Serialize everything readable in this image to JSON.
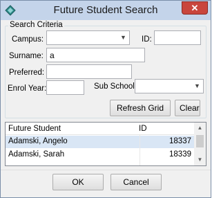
{
  "window": {
    "title": "Future Student Search",
    "close_label": "✕",
    "icon": "diamond-app-icon"
  },
  "search": {
    "legend": "Search Criteria",
    "campus_label": "Campus:",
    "campus_value": "",
    "id_label": "ID:",
    "id_value": "",
    "surname_label": "Surname:",
    "surname_value": "a",
    "preferred_label": "Preferred:",
    "preferred_value": "",
    "enrol_year_label": "Enrol Year:",
    "enrol_year_value": "",
    "sub_school_label": "Sub School:",
    "sub_school_value": "",
    "refresh_label": "Refresh Grid",
    "clear_label": "Clear"
  },
  "grid": {
    "columns": [
      "Future Student",
      "ID"
    ],
    "rows": [
      {
        "name": "Adamski, Angelo",
        "id": "18337",
        "selected": true
      },
      {
        "name": "Adamski, Sarah",
        "id": "18339",
        "selected": false
      }
    ]
  },
  "footer": {
    "ok_label": "OK",
    "cancel_label": "Cancel"
  },
  "colors": {
    "titlebar": "#c4d4ea",
    "selected_row": "#d9e6f5",
    "close_button": "#c9463d"
  }
}
